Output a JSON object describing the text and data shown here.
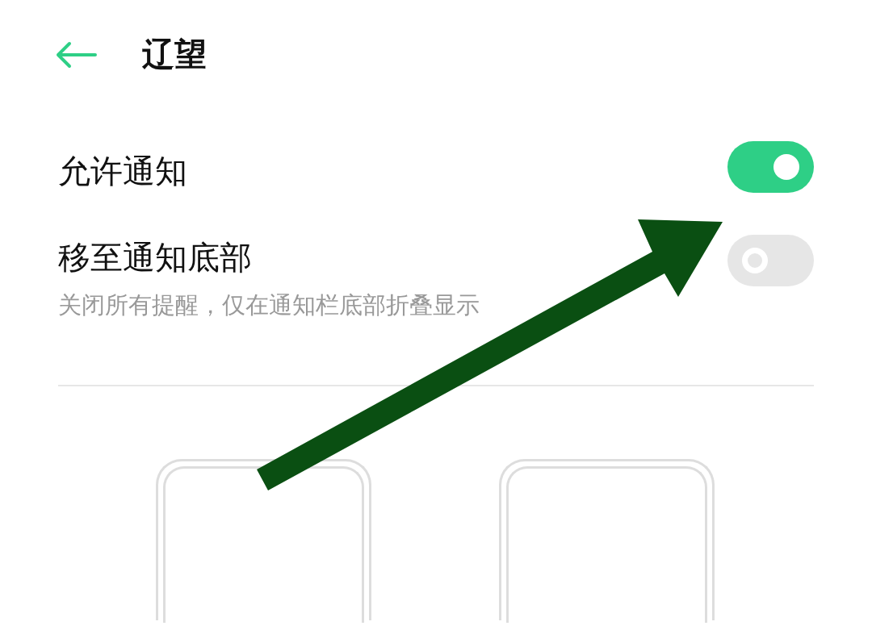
{
  "header": {
    "title": "辽望"
  },
  "settings": [
    {
      "kind": "toggle",
      "label": "允许通知",
      "on": true
    },
    {
      "kind": "toggle",
      "label": "移至通知底部",
      "description": "关闭所有提醒，仅在通知栏底部折叠显示",
      "on": false
    }
  ],
  "previews": [
    {
      "kind": "phone"
    },
    {
      "kind": "phone"
    }
  ],
  "annotation": {
    "kind": "arrow"
  }
}
